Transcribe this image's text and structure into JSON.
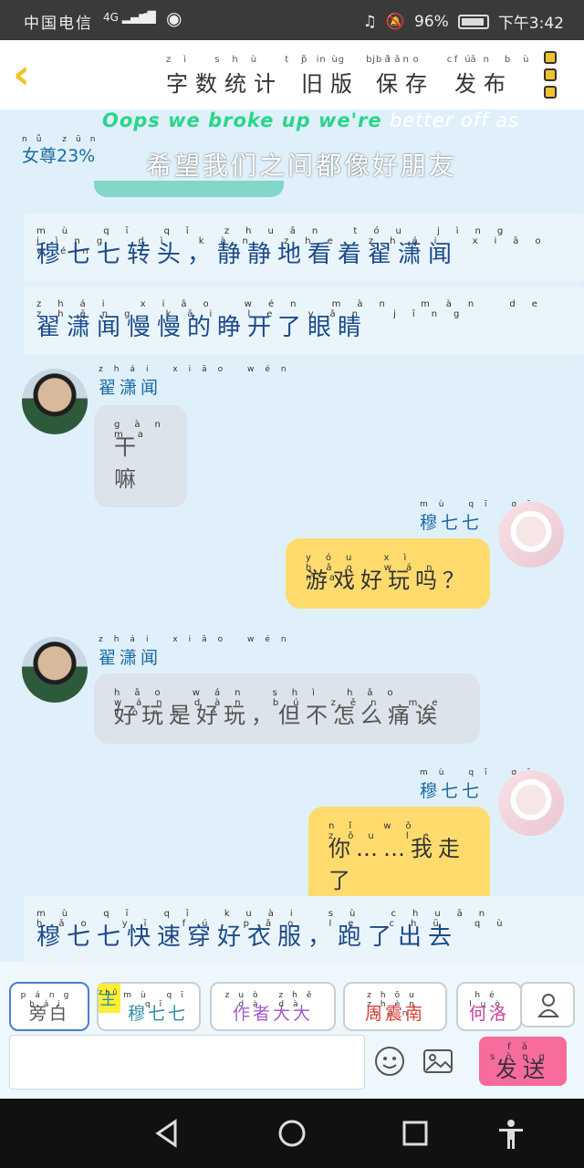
{
  "status_bar": {
    "carrier": "中国电信",
    "network": "4G",
    "battery": "96%",
    "time": "下午3:42"
  },
  "toolbar": {
    "items": [
      {
        "label": "字数统计",
        "pinyin": "zì shù tǒng jì"
      },
      {
        "label": "旧版",
        "pinyin": "jiù bǎn"
      },
      {
        "label": "保存",
        "pinyin": "bǎo cún"
      },
      {
        "label": "发布",
        "pinyin": "fā bù"
      }
    ]
  },
  "lyrics": {
    "line1_green": "Oops we broke up we're",
    "line1_white": "better off as",
    "line2": "希望我们之间都像好朋友"
  },
  "female_ratio": {
    "pinyin": "nǚ zūn",
    "text": "女尊23%"
  },
  "messages": [
    {
      "type": "narration",
      "pinyin": "mù qī qī zhuǎn tóu jìng jìng dì kàn zhe zhái xiāo wén",
      "text": "穆七七转头，静静地看着翟潇闻"
    },
    {
      "type": "narration",
      "pinyin": "zhái xiāo wén màn màn de zhēng kāi le yǎn jīng",
      "text": "翟潇闻慢慢的睁开了眼睛"
    },
    {
      "type": "left",
      "name_pinyin": "zhái xiāo wén",
      "name": "翟潇闻",
      "pinyin": "gàn ma",
      "text": "干嘛"
    },
    {
      "type": "right",
      "name_pinyin": "mù qī qī",
      "name": "穆七七",
      "pinyin": "yóu xì hǎo wán ma",
      "text": "游戏好玩吗？"
    },
    {
      "type": "left",
      "name_pinyin": "zhái xiāo wén",
      "name": "翟潇闻",
      "pinyin": "hǎo wán shì hǎo wán dàn bú zěn me tòng ei",
      "text": "好玩是好玩，但不怎么痛诶"
    },
    {
      "type": "right",
      "name_pinyin": "mù qī qī",
      "name": "穆七七",
      "pinyin": "nǐ wǒ zǒu le",
      "text": "你……我走了"
    },
    {
      "type": "narration",
      "pinyin": "mù qī qī kuài sù chuān hǎo yī fú pǎo le chū qù",
      "text": "穆七七快速穿好衣服，跑了出去"
    }
  ],
  "roles": [
    {
      "pinyin": "páng bái",
      "label": "旁白"
    },
    {
      "tag": "主",
      "tag_pinyin": "zhǔ",
      "pinyin": "mù qī qī",
      "label": "穆七七"
    },
    {
      "pinyin": "zuò zhě dà dà",
      "label": "作者大大"
    },
    {
      "pinyin": "zhōu zhèn nán",
      "label": "周震南"
    },
    {
      "pinyin": "hé luò",
      "label": "何洛"
    }
  ],
  "input": {
    "placeholder": ""
  },
  "send": {
    "pinyin": "fā sòng",
    "label": "发送"
  },
  "colors": {
    "accent_yellow": "#f2c12e",
    "bubble_yellow": "#ffdb6e",
    "send_pink": "#f86b9d",
    "name_blue": "#1c6aa0"
  }
}
